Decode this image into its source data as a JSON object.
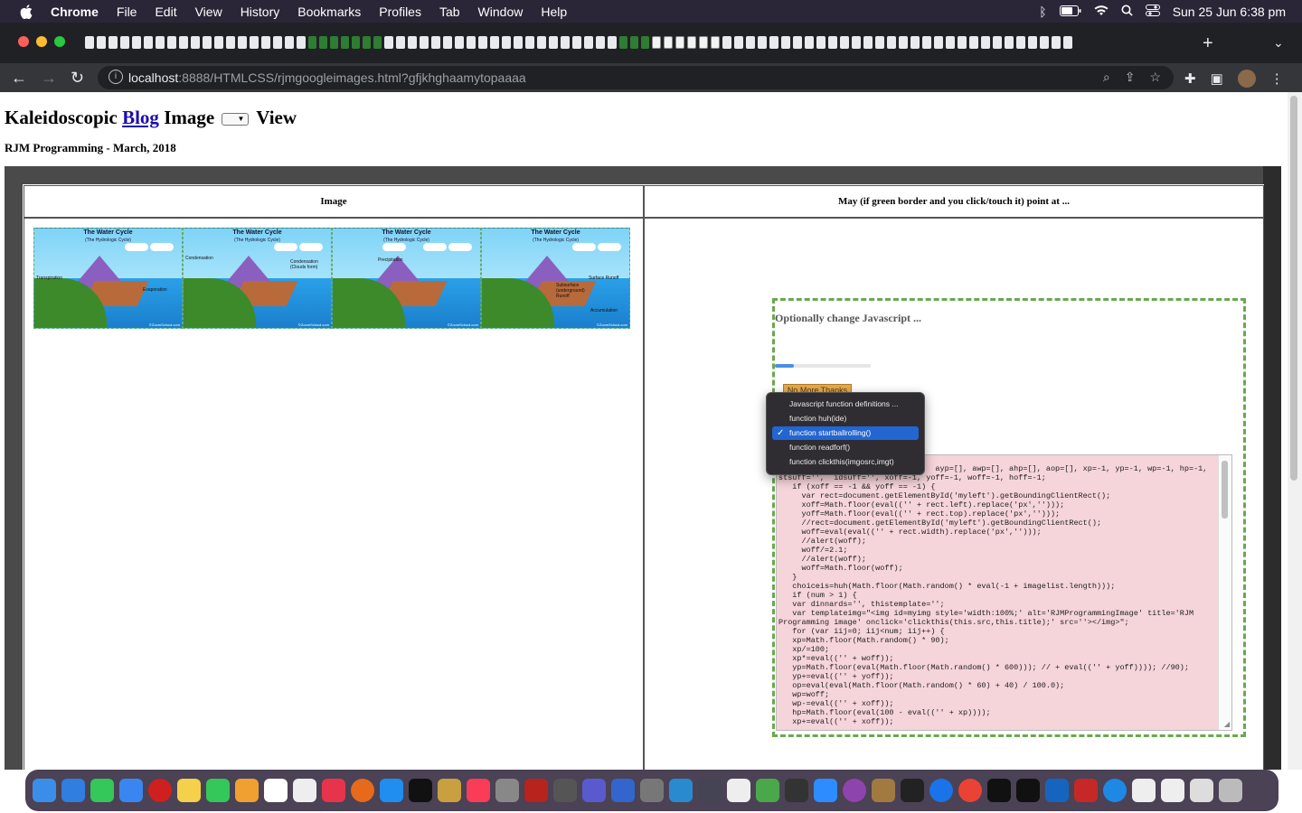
{
  "menubar": {
    "app": "Chrome",
    "items": [
      "File",
      "Edit",
      "View",
      "History",
      "Bookmarks",
      "Profiles",
      "Tab",
      "Window",
      "Help"
    ],
    "clock": "Sun 25 Jun  6:38 pm"
  },
  "browser": {
    "url_host": "localhost",
    "url_rest": ":8888/HTMLCSS/rjmgoogleimages.html?gfjkhghaamytopaaaa"
  },
  "page": {
    "title_pre": "Kaleidoscopic ",
    "title_link": "Blog",
    "title_mid": " Image ",
    "title_post": " View",
    "subtitle": "RJM Programming - March, 2018",
    "col1_header": "Image",
    "col2_header": "May (if green border and you click/touch it) point at ...",
    "optional_heading": "Optionally change Javascript ...",
    "progress_percent": 20,
    "no_more_button": "No More Thanks"
  },
  "images": [
    {
      "title": "The Water Cycle",
      "subtitle": "(The Hydrologic Cycle)",
      "labels": [
        "Transpiration",
        "Evaporation"
      ],
      "credit": "©ZoomSchool.com"
    },
    {
      "title": "The Water Cycle",
      "subtitle": "(The Hydrologic Cycle)",
      "labels": [
        "Condensation",
        "Condensation (Clouds form)"
      ],
      "credit": "©ZoomSchool.com"
    },
    {
      "title": "The Water Cycle",
      "subtitle": "(The Hydrologic Cycle)",
      "labels": [
        "Precipitation"
      ],
      "credit": "©ZoomSchool.com"
    },
    {
      "title": "The Water Cycle",
      "subtitle": "(The Hydrologic Cycle)",
      "labels": [
        "Surface Runoff",
        "Subsurface (underground) Runoff",
        "Accumulation"
      ],
      "credit": "©ZoomSchool.com"
    }
  ],
  "dropdown": {
    "options": [
      "Javascript function definitions ...",
      "function huh(ide)",
      "function startballrolling()",
      "function readforf()",
      "function clickthis(imgosrc,imgt)"
    ],
    "selected_index": 2
  },
  "code_lines": [
    "                                  ayp=[], awp=[], ahp=[], aop=[], xp=-1, yp=-1, wp=-1, hp=-1,",
    "stsuff='',  idsuff='', xoff=-1, yoff=-1, woff=-1, hoff=-1;",
    "   if (xoff == -1 && yoff == -1) {",
    "     var rect=document.getElementById('myleft').getBoundingClientRect();",
    "     xoff=Math.floor(eval(('' + rect.left).replace('px','')));",
    "     yoff=Math.floor(eval(('' + rect.top).replace('px','')));",
    "     //rect=document.getElementById('myleft').getBoundingClientRect();",
    "     woff=eval(eval(('' + rect.width).replace('px','')));",
    "     //alert(woff);",
    "     woff/=2.1;",
    "     //alert(woff);",
    "     woff=Math.floor(woff);",
    "   }",
    "   choiceis=huh(Math.floor(Math.random() * eval(-1 + imagelist.length)));",
    "   if (num > 1) {",
    "   var dinnards='', thistemplate='';",
    "   var templateimg=\"<img id=myimg style='width:100%;' alt='RJMProgrammingImage' title='RJM",
    "Programming image' onclick='clickthis(this.src,this.title);' src=''></img>\";",
    "   for (var iij=0; iij<num; iij++) {",
    "   xp=Math.floor(Math.random() * 90);",
    "   xp/=100;",
    "   xp*=eval(('' + woff));",
    "   yp=Math.floor(eval(Math.floor(Math.random() * 600))); // + eval(('' + yoff)))); //90);",
    "   yp+=eval(('' + yoff));",
    "   op=eval(eval(Math.floor(Math.random() * 60) + 40) / 100.0);",
    "   wp=woff;",
    "   wp-=eval(('' + xoff));",
    "   hp=Math.floor(eval(100 - eval(('' + xp))));",
    "   xp+=eval(('' + xoff));"
  ]
}
